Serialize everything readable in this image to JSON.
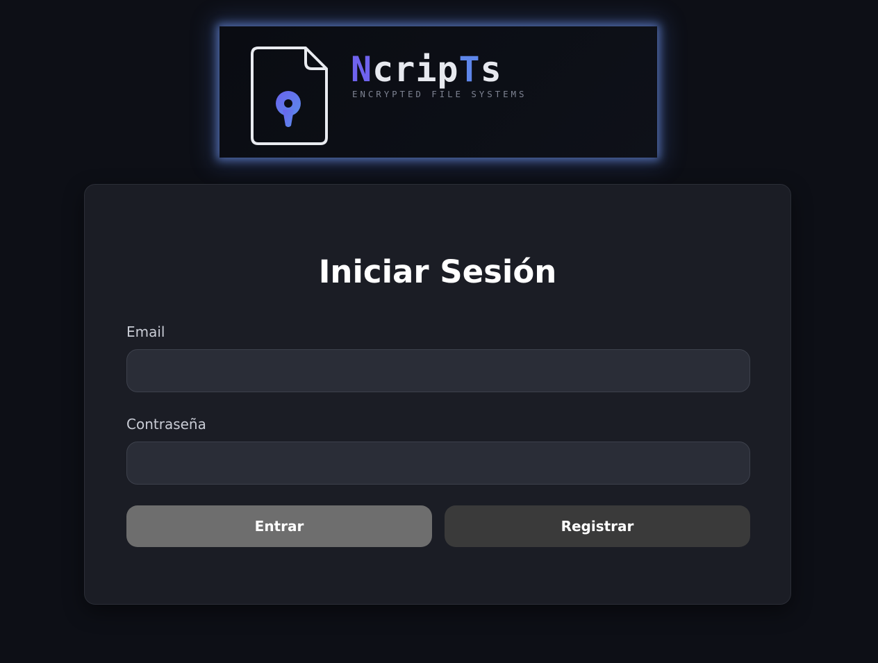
{
  "brand": {
    "name_first": "N",
    "name_middle": "crip",
    "name_t": "T",
    "name_last": "s",
    "tagline": "ENCRYPTED FILE SYSTEMS",
    "colors": {
      "accent_n": "#6f63ee",
      "accent_t": "#5e86ea",
      "glow": "#7aa0ff"
    },
    "logo_icon": "encrypted-file-icon"
  },
  "login": {
    "title": "Iniciar Sesión",
    "email_label": "Email",
    "email_value": "",
    "password_label": "Contraseña",
    "password_value": "",
    "login_button": "Entrar",
    "register_button": "Registrar"
  }
}
